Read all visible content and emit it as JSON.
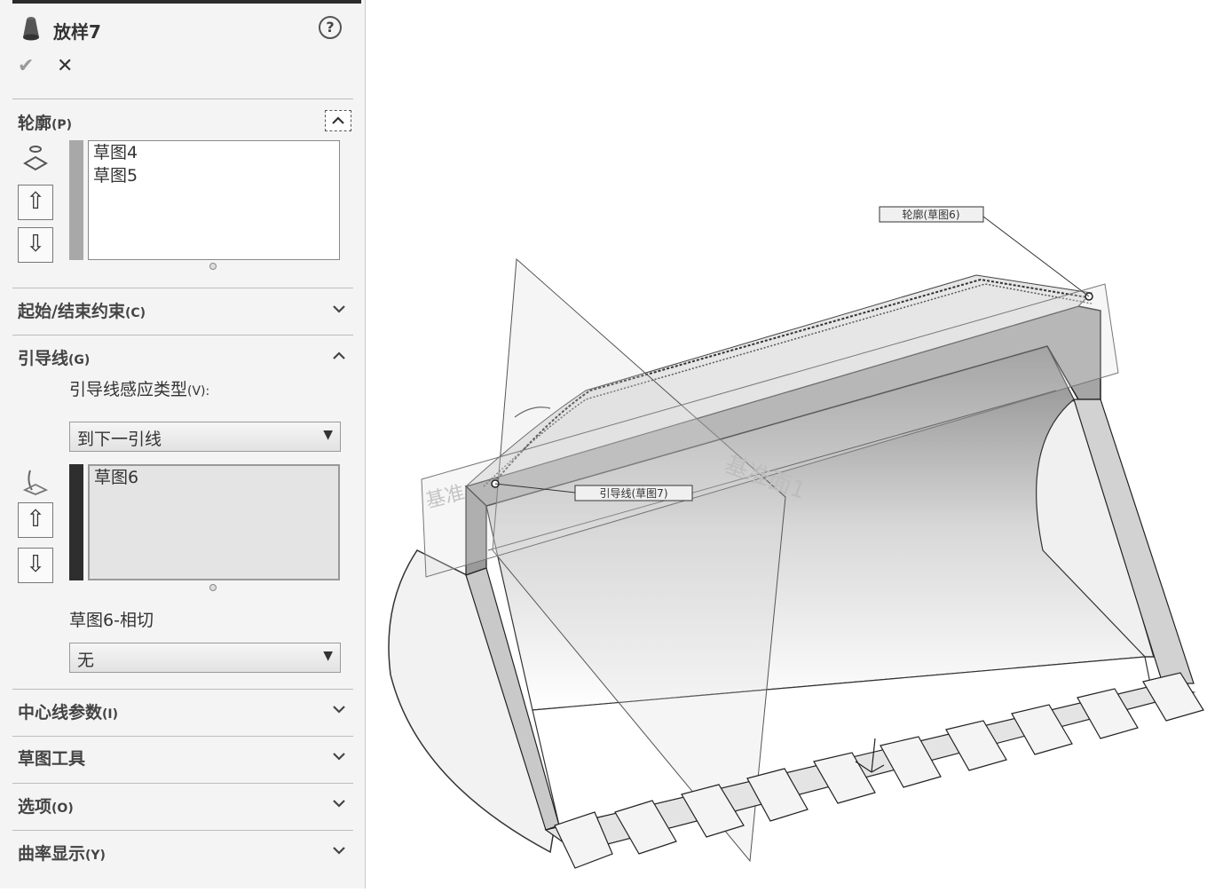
{
  "feature": {
    "title": "放样7",
    "help_icon": "help-icon",
    "ok_icon": "checkmark-icon",
    "cancel_icon": "close-icon"
  },
  "profiles_section": {
    "title": "轮廓",
    "shortcut": "(P)",
    "items": [
      "草图4",
      "草图5"
    ],
    "icon": "profile-icon",
    "bar_color": "#a8a8a8"
  },
  "start_end_section": {
    "title": "起始/结束约束",
    "shortcut": "(C)"
  },
  "guide_section": {
    "title": "引导线",
    "shortcut": "(G)",
    "influence_label": "引导线感应类型",
    "influence_shortcut": "(V):",
    "influence_value": "到下一引线",
    "items": [
      "草图6"
    ],
    "bar_color": "#2e2e2e",
    "tangency_label": "草图6-相切",
    "tangency_value": "无"
  },
  "centerline_section": {
    "title": "中心线参数",
    "shortcut": "(I)"
  },
  "sketch_tools_section": {
    "title": "草图工具"
  },
  "options_section": {
    "title": "选项",
    "shortcut": "(O)"
  },
  "curvature_section": {
    "title": "曲率显示",
    "shortcut": "(Y)"
  },
  "viewport": {
    "callout_profile": "轮廓(草图6)",
    "callout_guide": "引导线(草图7)",
    "plane_label": "基准面1",
    "plane_label_left": "基准"
  }
}
